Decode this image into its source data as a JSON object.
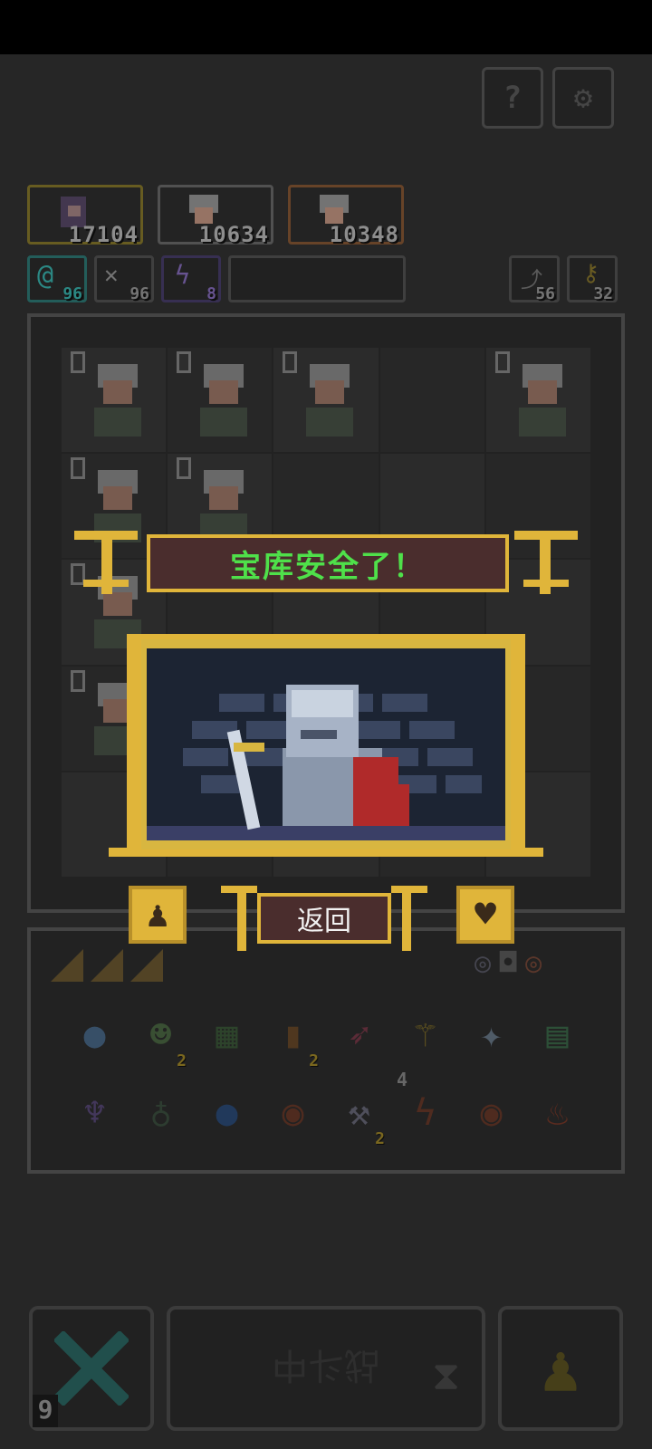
{
  "top_buttons": {
    "help_icon": "question-icon",
    "settings_icon": "gear-icon"
  },
  "party": [
    {
      "score": "17104",
      "frame": "gold"
    },
    {
      "score": "10634",
      "frame": "gray"
    },
    {
      "score": "10348",
      "frame": "orange"
    }
  ],
  "resources": [
    {
      "icon": "at-icon",
      "value": "96",
      "color": "#3ab6b0"
    },
    {
      "icon": "bird-icon",
      "value": "96",
      "color": "#9a9a9a"
    },
    {
      "icon": "lightning-icon",
      "value": "8",
      "color": "#8a6fc0"
    }
  ],
  "right_counters": [
    {
      "icon": "arrow-icon",
      "value": "56"
    },
    {
      "icon": "key-icon",
      "value": "32"
    }
  ],
  "board": {
    "cells": [
      [
        "0",
        "0",
        "0",
        "",
        "0"
      ],
      [
        "0",
        "0",
        "",
        "",
        ""
      ],
      [
        "0",
        "",
        "",
        "",
        ""
      ],
      [
        "0",
        "",
        "",
        "",
        ""
      ],
      [
        "",
        "",
        "",
        "",
        ""
      ]
    ]
  },
  "inventory": {
    "items": [
      {
        "icon": "bomb-icon",
        "qty": ""
      },
      {
        "icon": "goblin-icon",
        "qty": "2"
      },
      {
        "icon": "map-icon",
        "qty": ""
      },
      {
        "icon": "potion-jar-icon",
        "qty": "2"
      },
      {
        "icon": "arrow-icon",
        "qty": ""
      },
      {
        "icon": "wand-icon",
        "qty": ""
      },
      {
        "icon": "shuriken-icon",
        "qty": ""
      },
      {
        "icon": "scroll-icon",
        "qty": ""
      },
      {
        "icon": "bat-icon",
        "qty": ""
      },
      {
        "icon": "bag-icon",
        "qty": ""
      },
      {
        "icon": "droplet-icon",
        "qty": ""
      },
      {
        "icon": "blue-orb-icon",
        "qty": ""
      },
      {
        "icon": "axe-icon",
        "qty": "2"
      },
      {
        "icon": "lightning-book-icon",
        "qty": ""
      },
      {
        "icon": "water-book-icon",
        "qty": ""
      },
      {
        "icon": "fire-book-icon",
        "qty": ""
      }
    ],
    "extra_count": "4"
  },
  "bottom": {
    "battle_label": "战斗中",
    "counter": "9"
  },
  "modal": {
    "title": "宝库安全了！",
    "return_label": "返回",
    "title_color": "#4fe04a",
    "frame_color": "#e0b53a"
  }
}
